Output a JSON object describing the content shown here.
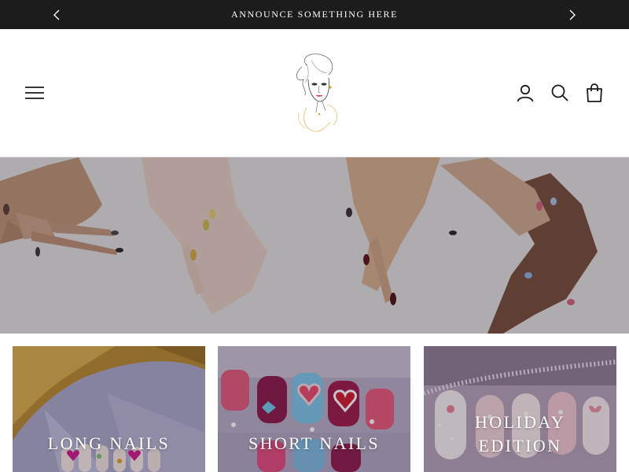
{
  "announcement": {
    "text": "ANNOUNCE SOMETHING HERE",
    "prev_icon": "chevron-left-icon",
    "next_icon": "chevron-right-icon"
  },
  "header": {
    "menu_icon": "hamburger-menu-icon",
    "logo": "woman-portrait-logo",
    "account_icon": "account-icon",
    "search_icon": "search-icon",
    "cart_icon": "shopping-bag-icon"
  },
  "hero": {
    "image": "hands-with-painted-nails"
  },
  "collections": [
    {
      "title": "LONG NAILS"
    },
    {
      "title": "SHORT NAILS"
    },
    {
      "title_line1": "HOLIDAY",
      "title_line2": "EDITION"
    }
  ],
  "colors": {
    "announcement_bg": "#1c1c1c",
    "text": "#1c1c1c",
    "background": "#ffffff"
  }
}
